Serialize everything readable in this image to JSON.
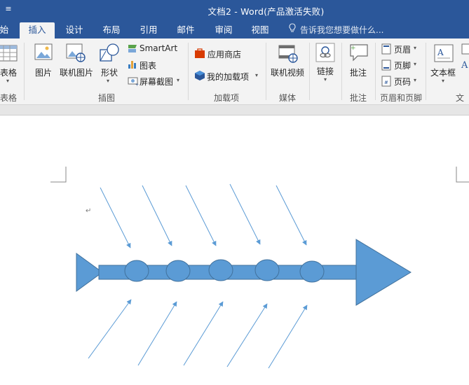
{
  "window": {
    "title": "文档2 - Word(产品激活失败)",
    "quick_access_glyph": "≡"
  },
  "tabs": [
    {
      "label": "始",
      "active": false
    },
    {
      "label": "插入",
      "active": true
    },
    {
      "label": "设计",
      "active": false
    },
    {
      "label": "布局",
      "active": false
    },
    {
      "label": "引用",
      "active": false
    },
    {
      "label": "邮件",
      "active": false
    },
    {
      "label": "审阅",
      "active": false
    },
    {
      "label": "视图",
      "active": false
    }
  ],
  "tell_me": {
    "icon": "lightbulb-icon",
    "placeholder": "告诉我您想要做什么..."
  },
  "ribbon": {
    "table": {
      "button": "表格",
      "group": "表格"
    },
    "illustrations": {
      "group": "插图",
      "picture": "图片",
      "online_picture": "联机图片",
      "shapes": "形状",
      "smartart": "SmartArt",
      "chart": "图表",
      "screenshot": "屏幕截图"
    },
    "addins": {
      "group": "加载项",
      "store": "应用商店",
      "my_addins": "我的加载项"
    },
    "media": {
      "group": "媒体",
      "online_video": "联机视频"
    },
    "links": {
      "button": "链接"
    },
    "comments": {
      "group": "批注",
      "comment": "批注"
    },
    "header_footer": {
      "group": "页眉和页脚",
      "header": "页眉",
      "footer": "页脚",
      "page_number": "页码"
    },
    "text": {
      "group": "文",
      "textbox": "文本框"
    }
  },
  "document": {
    "paragraph_mark": "↵",
    "diagram": {
      "type": "fishbone",
      "spine_color": "#5b9bd5",
      "node_count": 5,
      "bone_pairs": 5
    }
  },
  "colors": {
    "accent": "#2b579a",
    "ribbon_bg": "#f3f3f3",
    "shape_fill": "#5b9bd5",
    "shape_stroke": "#41719c"
  }
}
